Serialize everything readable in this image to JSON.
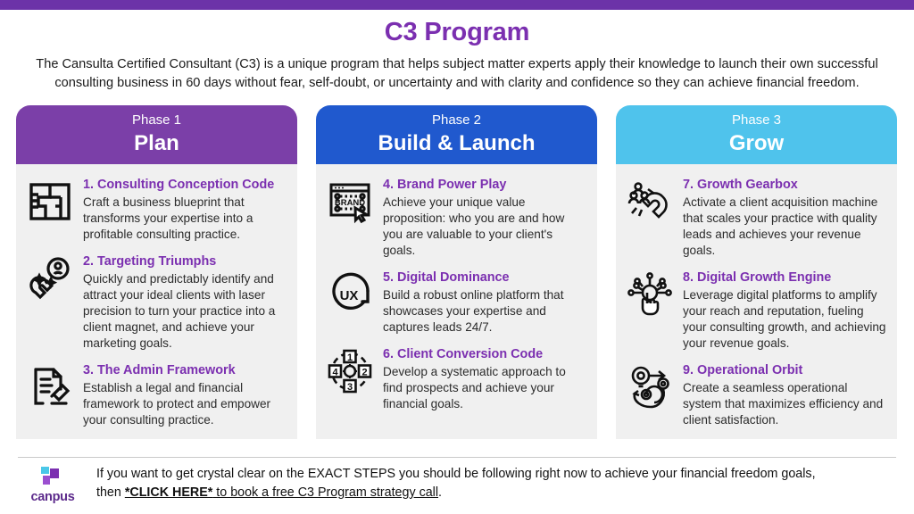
{
  "accent_colors": {
    "top_bar": "#6C33A8",
    "title_purple": "#7B2FB0",
    "phase1": "#7B3FA8",
    "phase2": "#2059CE",
    "phase3": "#4FC3EC",
    "card_bg": "#f0f0f0"
  },
  "header": {
    "title": "C3 Program",
    "intro": "The Cansulta Certified Consultant (C3) is a unique program that helps subject matter experts apply their knowledge to launch their own successful consulting business in 60 days without fear, self-doubt, or uncertainty and with clarity and confidence so they can achieve financial freedom."
  },
  "phases": [
    {
      "label": "Phase 1",
      "name": "Plan",
      "color": "#7B3FA8",
      "items": [
        {
          "icon": "blueprint-icon",
          "title": "1. Consulting Conception Code",
          "desc": "Craft a business blueprint that transforms your expertise into a profitable consulting practice."
        },
        {
          "icon": "magnet-target-icon",
          "title": "2. Targeting Triumphs",
          "desc": "Quickly and predictably identify and attract your ideal clients with laser precision to turn your practice into a client magnet, and achieve your marketing goals."
        },
        {
          "icon": "legal-document-gavel-icon",
          "title": "3. The Admin Framework",
          "desc": "Establish a legal and financial framework to protect and empower your consulting practice."
        }
      ]
    },
    {
      "label": "Phase 2",
      "name": "Build & Launch",
      "color": "#2059CE",
      "items": [
        {
          "icon": "brand-browser-click-icon",
          "title": "4. Brand Power Play",
          "desc": "Achieve your unique value proposition: who you are and how you are valuable to your client's goals."
        },
        {
          "icon": "ux-circle-icon",
          "title": "5. Digital Dominance",
          "desc": "Build a robust online platform that showcases your expertise and captures leads 24/7."
        },
        {
          "icon": "process-cycle-1234-icon",
          "title": "6. Client Conversion Code",
          "desc": "Develop a systematic approach to find prospects and achieve your financial goals."
        }
      ]
    },
    {
      "label": "Phase 3",
      "name": "Grow",
      "color": "#4FC3EC",
      "items": [
        {
          "icon": "magnet-people-icon",
          "title": "7. Growth Gearbox",
          "desc": "Activate a client acquisition machine that scales your practice with quality leads and achieves your revenue goals."
        },
        {
          "icon": "digital-network-hand-icon",
          "title": "8. Digital Growth Engine",
          "desc": "Leverage digital platforms to amplify your reach and reputation, fueling your consulting growth, and achieving your revenue goals."
        },
        {
          "icon": "lightbulb-gear-icon",
          "title": "9. Operational Orbit",
          "desc": "Create a seamless operational system that maximizes efficiency and client satisfaction."
        }
      ]
    }
  ],
  "footer": {
    "logo_text": "canpus",
    "line1": "If you want to get crystal clear on the EXACT STEPS you should be following right now to achieve your financial freedom goals,",
    "line2_prefix": "then ",
    "cta_bold": "*CLICK HERE*",
    "cta_rest": " to book a free C3 Program strategy call",
    "line2_suffix": "."
  }
}
